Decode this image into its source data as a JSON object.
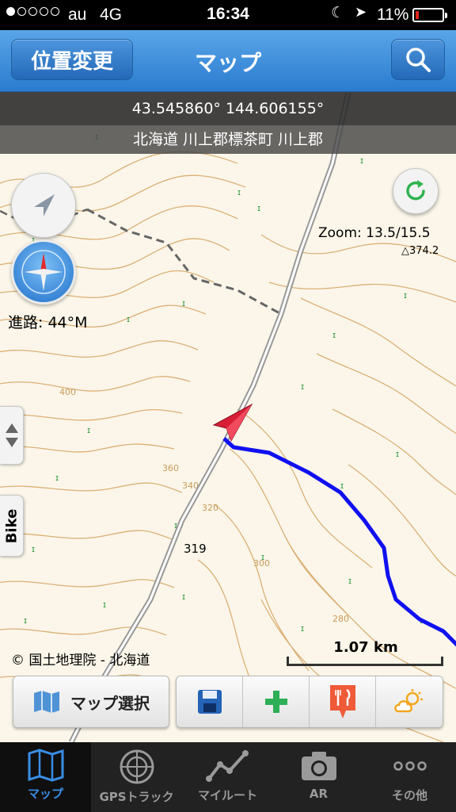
{
  "status_bar": {
    "carrier": "au",
    "network": "4G",
    "time": "16:34",
    "battery_percent": "11%",
    "battery_level": 0.11,
    "icons": [
      "signal-dots-icon",
      "moon-icon",
      "location-arrow-icon",
      "battery-icon"
    ]
  },
  "nav": {
    "left_button": "位置変更",
    "title": "マップ",
    "right_icon": "search-icon"
  },
  "coordinates": "43.545860° 144.606155°",
  "address": "北海道 川上郡標茶町 川上郡",
  "map": {
    "heading": "進路: 44°M",
    "zoom": "Zoom: 13.5/15.5",
    "spot_height": "374.2",
    "road_number": "319",
    "contour_labels": [
      "400",
      "360",
      "340",
      "320",
      "300",
      "280"
    ],
    "attribution": "© 国土地理院 - 北海道",
    "scale": "1.07 km",
    "side_tab": "Bike",
    "colors": {
      "track": "#1010f0",
      "marker": "#d81e35",
      "contour": "#d8a96a",
      "trail": "#666666"
    }
  },
  "toolbar": {
    "map_select": "マップ選択",
    "icons": [
      "save-icon",
      "add-icon",
      "restaurant-icon",
      "weather-icon"
    ]
  },
  "tabs": [
    {
      "label": "マップ",
      "icon": "map-icon",
      "active": true
    },
    {
      "label": "GPSトラック",
      "icon": "radar-icon",
      "active": false
    },
    {
      "label": "マイルート",
      "icon": "route-icon",
      "active": false
    },
    {
      "label": "AR",
      "icon": "camera-icon",
      "active": false
    },
    {
      "label": "その他",
      "icon": "more-icon",
      "active": false
    }
  ]
}
